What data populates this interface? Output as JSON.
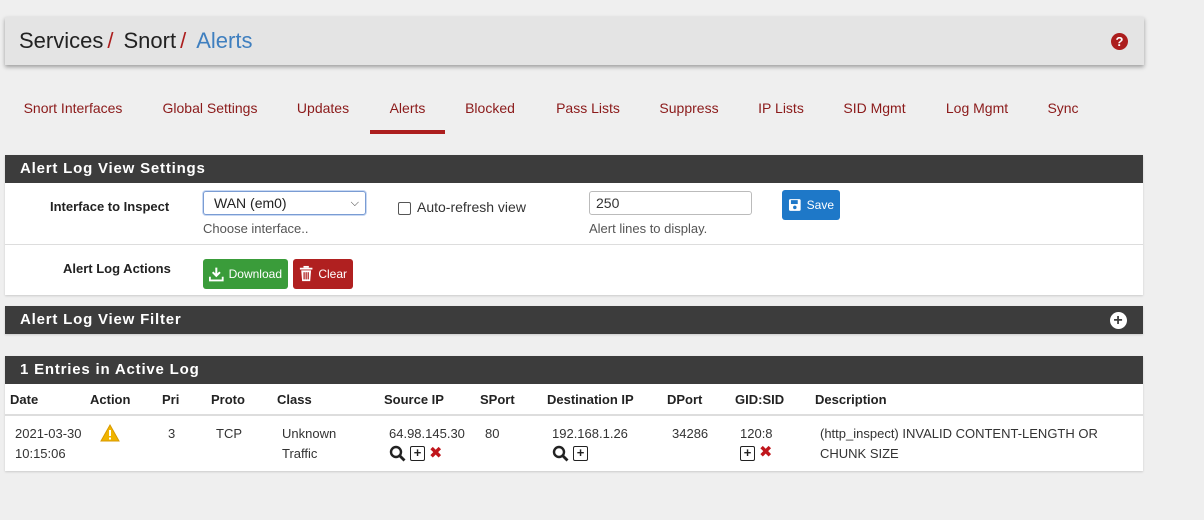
{
  "breadcrumb": {
    "items": [
      "Services",
      "Snort"
    ],
    "separator": "/",
    "active": "Alerts"
  },
  "help_icon": "question-circle-icon",
  "tabs": [
    {
      "label": "Snort Interfaces"
    },
    {
      "label": "Global Settings"
    },
    {
      "label": "Updates"
    },
    {
      "label": "Alerts",
      "active": true
    },
    {
      "label": "Blocked"
    },
    {
      "label": "Pass Lists"
    },
    {
      "label": "Suppress"
    },
    {
      "label": "IP Lists"
    },
    {
      "label": "SID Mgmt"
    },
    {
      "label": "Log Mgmt"
    },
    {
      "label": "Sync"
    }
  ],
  "settings": {
    "heading": "Alert Log View Settings",
    "interface_label": "Interface to Inspect",
    "interface_value": "WAN (em0)",
    "interface_hint": "Choose interface..",
    "autorefresh_label": "Auto-refresh view",
    "autorefresh_checked": false,
    "lines_value": "250",
    "lines_hint": "Alert lines to display.",
    "save_label": "Save",
    "actions_label": "Alert Log Actions",
    "download_label": "Download",
    "clear_label": "Clear"
  },
  "filter": {
    "heading": "Alert Log View Filter"
  },
  "log": {
    "heading": "1 Entries in Active Log",
    "columns": [
      "Date",
      "Action",
      "Pri",
      "Proto",
      "Class",
      "Source IP",
      "SPort",
      "Destination IP",
      "DPort",
      "GID:SID",
      "Description"
    ],
    "rows": [
      {
        "date": "2021-03-30",
        "time": "10:15:06",
        "action_icon": "warning-triangle-icon",
        "pri": "3",
        "proto": "TCP",
        "class_line1": "Unknown",
        "class_line2": "Traffic",
        "src_ip": "64.98.145.30",
        "sport": "80",
        "dst_ip": "192.168.1.26",
        "dport": "34286",
        "gidsid": "120:8",
        "desc_line1": "(http_inspect) INVALID CONTENT-LENGTH OR",
        "desc_line2": "CHUNK SIZE"
      }
    ]
  },
  "colors": {
    "accent_red": "#ac1e1e",
    "link_blue": "#3f7fbf",
    "heading_dark": "#3c3c3c",
    "save_blue": "#1e78c8",
    "download_green": "#3a9c3a"
  }
}
